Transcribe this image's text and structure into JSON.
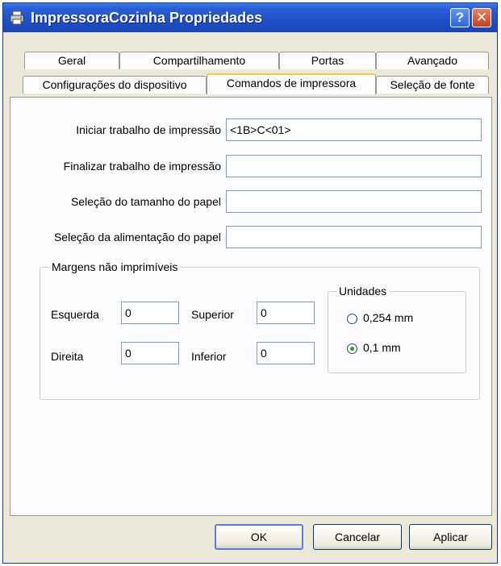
{
  "window": {
    "title": "ImpressoraCozinha Propriedades",
    "help_symbol": "?",
    "close_symbol": "✕",
    "icon": "printer-icon"
  },
  "tabs_row1": [
    {
      "label": "Geral"
    },
    {
      "label": "Compartilhamento"
    },
    {
      "label": "Portas"
    },
    {
      "label": "Avançado"
    }
  ],
  "tabs_row2": [
    {
      "label": "Configurações do dispositivo"
    },
    {
      "label": "Comandos de impressora",
      "active": true
    },
    {
      "label": "Seleção de fonte"
    }
  ],
  "commands": {
    "start_job": {
      "label": "Iniciar trabalho de impressão",
      "value": "<1B>C<01>"
    },
    "end_job": {
      "label": "Finalizar trabalho de impressão",
      "value": ""
    },
    "paper_size": {
      "label": "Seleção do tamanho do papel",
      "value": ""
    },
    "paper_feed": {
      "label": "Seleção da alimentação do papel",
      "value": ""
    }
  },
  "margins": {
    "title": "Margens não imprimíveis",
    "left": {
      "label": "Esquerda",
      "value": "0"
    },
    "top": {
      "label": "Superior",
      "value": "0"
    },
    "right": {
      "label": "Direita",
      "value": "0"
    },
    "bottom": {
      "label": "Inferior",
      "value": "0"
    }
  },
  "units": {
    "title": "Unidades",
    "options": [
      {
        "label": "0,254 mm",
        "checked": false
      },
      {
        "label": "0,1 mm",
        "checked": true
      }
    ]
  },
  "buttons": {
    "ok": "OK",
    "cancel": "Cancelar",
    "apply": "Aplicar"
  }
}
